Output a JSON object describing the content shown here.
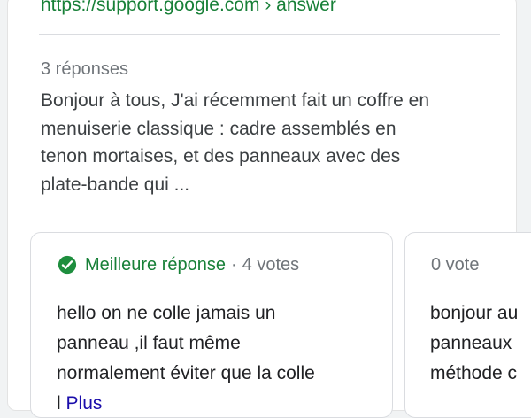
{
  "result": {
    "url": "https://support.google.com › answer",
    "reply_count": "3 réponses",
    "snippet_lines": [
      "Bonjour à tous, J'ai récemment fait un coffre en",
      "menuiserie classique : cadre assemblés en",
      "tenon mortaises, et des panneaux avec des",
      "plate-bande qui ..."
    ]
  },
  "answers": [
    {
      "badge": "Meilleure réponse",
      "separator": "·",
      "votes": "4 votes",
      "lines": [
        "hello on ne colle jamais un",
        "panneau ,il faut même",
        "normalement éviter que la colle"
      ],
      "partial_line": "l",
      "more_link": "Plus"
    },
    {
      "votes": "0 vote",
      "lines": [
        "bonjour au",
        "panneaux",
        "méthode c"
      ]
    }
  ],
  "colors": {
    "url": "#188038",
    "best_answer": "#188038",
    "muted": "#70757a",
    "text": "#202124",
    "link": "#1a0dab"
  },
  "icons": {
    "best_answer": "check-circle-icon"
  }
}
